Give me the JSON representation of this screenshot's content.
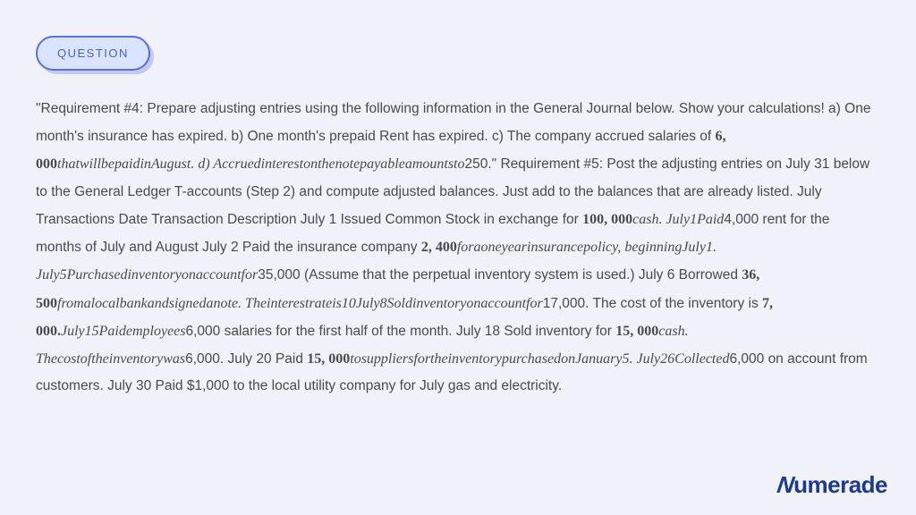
{
  "badge": {
    "label": "QUESTION"
  },
  "content": {
    "part1": "\"Requirement #4: Prepare adjusting entries using the following information in the General Journal below. Show your calculations! a) One month's insurance has expired. b) One month's prepaid Rent has expired. c) The company accrued salaries of ",
    "math1_num": "6, 000",
    "math1_text": "thatwillbepaidinAugust. d) Accruedinterestonthenotepayableamountsto",
    "part2": "250.\" Requirement #5: Post the adjusting entries on July 31 below to the General Ledger T-accounts (Step 2) and compute adjusted balances. Just add to the balances that are already listed. July Transactions Date Transaction Description July 1 Issued Common Stock in exchange for ",
    "math2_num": "100, 000",
    "math2_text": "cash. July1Paid",
    "part3": "4,000 rent for the months of July and August July 2 Paid the insurance company ",
    "math3_num": "2, 400",
    "math3_text": "foraoneyearinsurancepolicy, beginningJuly1. July5Purchasedinventoryonaccountfor",
    "part4": "35,000 (Assume that the perpetual inventory system is used.) July 6 Borrowed ",
    "math4_num": "36, 500",
    "math4_text": "fromalocalbankandsignedanote. Theinterestrateis10July8Soldinventoryonaccountfor",
    "part5": "17,000. The cost of the inventory is ",
    "math5_num": "7, 000.",
    "math5_text": "July15Paidemployees",
    "part6": "6,000 salaries for the first half of the month. July 18 Sold inventory for ",
    "math6_num": "15, 000",
    "math6_text": "cash. Thecostoftheinventorywas",
    "part7": "6,000. July 20 Paid ",
    "math7_num": "15, 000",
    "math7_text": "tosuppliersfortheinventorypurchasedonJanuary5. July26Collected",
    "part8": "6,000 on account from customers. July 30 Paid $1,000 to the local utility company for July gas and electricity."
  },
  "logo": {
    "text": "umerade",
    "first_letter": "N"
  }
}
